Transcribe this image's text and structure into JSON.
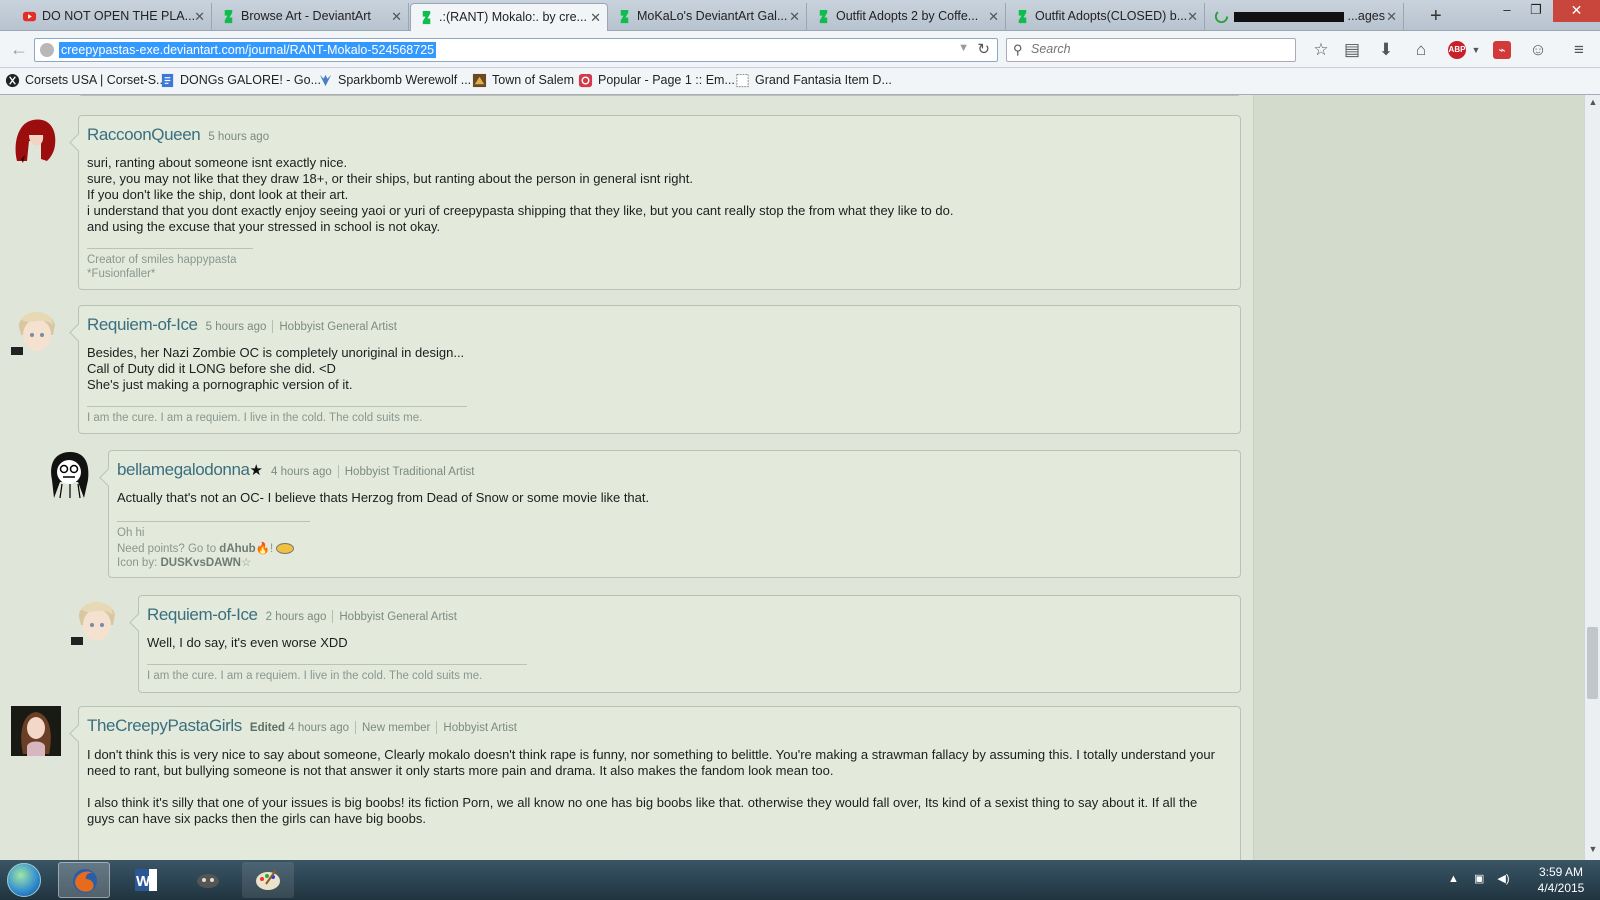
{
  "browser": {
    "tabs": [
      {
        "title": "DO NOT OPEN THE PLA...",
        "favicon": "youtube-icon",
        "active": false
      },
      {
        "title": "Browse Art - DeviantArt",
        "favicon": "deviantart-icon",
        "active": false
      },
      {
        "title": ".:(RANT) Mokalo:. by cre...",
        "favicon": "deviantart-icon",
        "active": true
      },
      {
        "title": "MoKaLo's DeviantArt Gal...",
        "favicon": "deviantart-icon",
        "active": false
      },
      {
        "title": "Outfit Adopts 2 by Coffe...",
        "favicon": "deviantart-icon",
        "active": false
      },
      {
        "title": "Outfit Adopts(CLOSED) b...",
        "favicon": "deviantart-icon",
        "active": false
      },
      {
        "title": "...ages",
        "favicon": "loading-icon",
        "active": false
      }
    ],
    "url": "creepypastas-exe.deviantart.com/journal/RANT-Mokalo-524568725",
    "search_placeholder": "Search",
    "bookmarks": [
      {
        "label": "Corsets USA | Corset-S...",
        "icon": "corset-icon"
      },
      {
        "label": "DONGs GALORE! - Go...",
        "icon": "docs-icon"
      },
      {
        "label": "Sparkbomb Werewolf ...",
        "icon": "sparkbomb-icon"
      },
      {
        "label": "Town of Salem",
        "icon": "town-of-salem-icon"
      },
      {
        "label": "Popular - Page 1 :: Em...",
        "icon": "popular-icon"
      },
      {
        "label": "Grand Fantasia Item D...",
        "icon": "blank-page-icon"
      }
    ]
  },
  "comments": [
    {
      "username": "RaccoonQueen",
      "time": "5 hours ago",
      "body": "suri, ranting about someone isnt exactly nice.\nsure, you may not like that they draw 18+, or their ships, but ranting about the person in general isnt right.\nIf you don't like the ship, dont look at their art.\ni understand that you dont exactly enjoy seeing yaoi or yuri of creepypasta shipping that they like, but you cant really stop the from what they like to do.\nand using the excuse that your stressed in school is not okay.",
      "signature": "Creator of smiles happypasta\n*Fusionfaller*"
    },
    {
      "username": "Requiem-of-Ice",
      "time": "5 hours ago",
      "role": "Hobbyist General Artist",
      "body": "Besides, her Nazi Zombie OC is completely unoriginal in design...\nCall of Duty did it LONG before she did. <D\nShe's just making a pornographic version of it.",
      "signature": "I am the cure. I am a requiem. I live in the cold. The cold suits me."
    },
    {
      "username": "bellamegalodonna",
      "time": "4 hours ago",
      "role": "Hobbyist Traditional Artist",
      "body": "Actually that's not an OC- I believe thats Herzog from Dead of Snow or some movie like that.",
      "signature": "Oh hi",
      "sig_points_prefix": "Need points? Go to ",
      "sig_points_link": "dAhub",
      "sig_icon_prefix": "Icon by: ",
      "sig_icon_link": "DUSKvsDAWN"
    },
    {
      "username": "Requiem-of-Ice",
      "time": "2 hours ago",
      "role": "Hobbyist General Artist",
      "body": "Well, I do say, it's even worse XDD",
      "signature": "I am the cure. I am a requiem. I live in the cold. The cold suits me."
    },
    {
      "username": "TheCreepyPastaGirls",
      "edited": "Edited",
      "time": "4 hours ago",
      "status": "New member",
      "role": "Hobbyist Artist",
      "body": "I don't think this is very nice to say about someone, Clearly mokalo doesn't think rape is funny, nor something to belittle. You're making a strawman fallacy by assuming this. I totally understand your need to rant, but bullying someone is not that answer it only starts more pain and drama. It also makes the fandom look mean too.\n\nI also think it's silly that one of your issues is big boobs! its fiction Porn, we all know no one has big boobs like that. otherwise they would fall over, Its kind of a sexist thing to say about it. If all the guys can have six packs then the girls can have big boobs."
    }
  ],
  "taskbar": {
    "apps": [
      "firefox-icon",
      "word-icon",
      "game-icon",
      "paint-icon"
    ],
    "time": "3:59 AM",
    "date": "4/4/2015"
  },
  "colors": {
    "page_bg": "#dfe6d9",
    "comment_bg": "#e3eadc",
    "username": "#3a6f80",
    "active_tab": "#f2f5f7",
    "url_selection": "#3399ff"
  }
}
